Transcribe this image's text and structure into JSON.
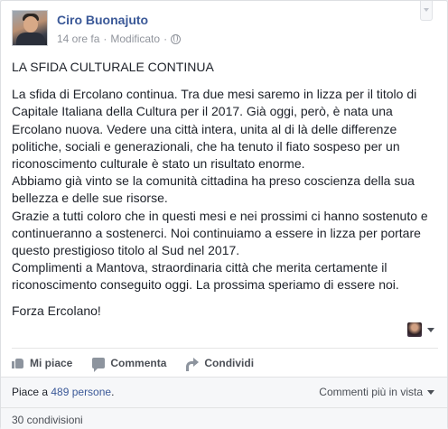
{
  "post": {
    "author": "Ciro Buonajuto",
    "time": "14 ore fa",
    "separator": "·",
    "edited": "Modificato",
    "audience_icon": "globe-icon",
    "title": "LA SFIDA CULTURALE CONTINUA",
    "paragraph1": "La sfida di Ercolano continua. Tra due mesi saremo in lizza per il titolo di Capitale Italiana della Cultura per il 2017. Già oggi, però, è nata una Ercolano nuova. Vedere una città intera, unita al di là delle differenze politiche, sociali e generazionali, che ha tenuto il fiato sospeso per un riconoscimento culturale è stato un risultato enorme.",
    "paragraph2": "Abbiamo già vinto se la comunità cittadina ha preso coscienza della sua bellezza e delle sue risorse.",
    "paragraph3": "Grazie a tutti coloro che in questi mesi e nei prossimi ci hanno sostenuto e continueranno a sostenerci. Noi continuiamo a essere in lizza per portare questo prestigioso titolo al Sud nel 2017.",
    "paragraph4": "Complimenti a Mantova, straordinaria città che merita certamente il riconoscimento conseguito oggi. La prossima speriamo di essere noi.",
    "closing": "Forza Ercolano!"
  },
  "actions": {
    "like": "Mi piace",
    "comment": "Commenta",
    "share": "Condividi"
  },
  "stats": {
    "likes_prefix": "Piace a ",
    "likes_count": "489 persone",
    "likes_suffix": ".",
    "comments_view": "Commenti più in vista",
    "shares": "30 condivisioni"
  },
  "colors": {
    "link": "#3b5998",
    "meta": "#90949c"
  }
}
